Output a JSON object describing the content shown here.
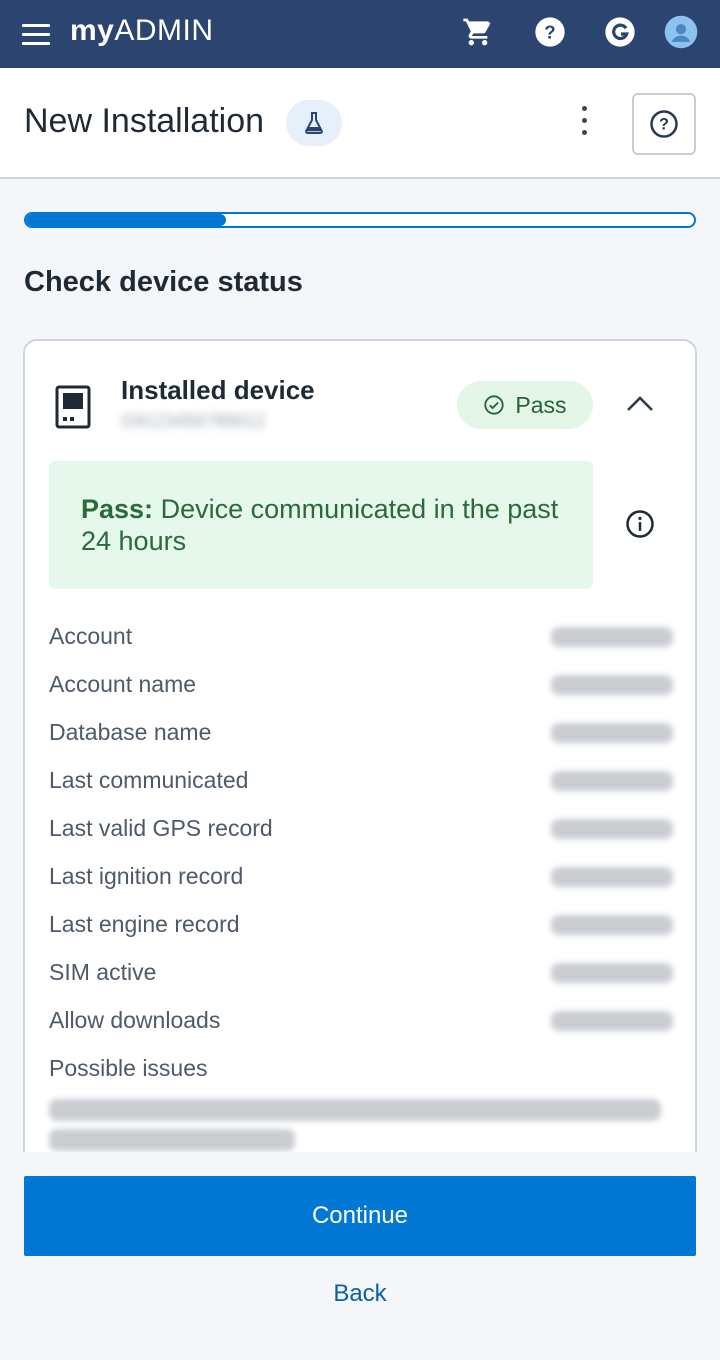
{
  "app": {
    "logo_bold": "my",
    "logo_light": "ADMIN",
    "icons": [
      "menu-icon",
      "cart-icon",
      "help-circle-icon",
      "g-brand-icon",
      "user-avatar-icon"
    ]
  },
  "header": {
    "title": "New Installation",
    "badge_icon": "flask-icon"
  },
  "progress": {
    "fraction": 0.3
  },
  "section": {
    "title": "Check device status"
  },
  "device": {
    "title": "Installed device",
    "serial": "G9123456789012",
    "status_label": "Pass",
    "status_color": "#22633a",
    "banner_prefix": "Pass:",
    "banner_text": " Device communicated in the past 24 hours",
    "details": [
      {
        "label": "Account"
      },
      {
        "label": "Account name"
      },
      {
        "label": "Database name"
      },
      {
        "label": "Last communicated"
      },
      {
        "label": "Last valid GPS record"
      },
      {
        "label": "Last ignition record"
      },
      {
        "label": "Last engine record"
      },
      {
        "label": "SIM active"
      },
      {
        "label": "Allow downloads"
      },
      {
        "label": "Possible issues"
      }
    ]
  },
  "footer": {
    "continue_label": "Continue",
    "back_label": "Back"
  },
  "colors": {
    "appbar": "#2b4470",
    "primary": "#0078d4",
    "success_bg": "#e6f8ec"
  }
}
